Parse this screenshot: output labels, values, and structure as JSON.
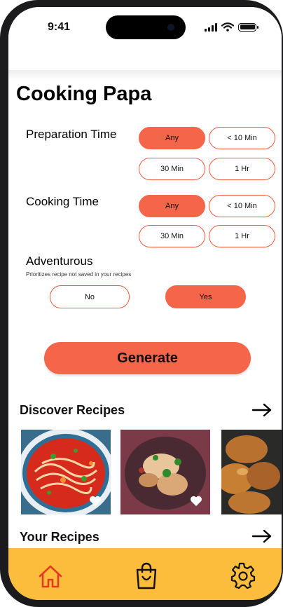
{
  "status": {
    "time": "9:41"
  },
  "app": {
    "title": "Cooking Papa"
  },
  "preparation": {
    "label": "Preparation Time",
    "options": [
      "Any",
      "< 10 Min",
      "30 Min",
      "1 Hr"
    ],
    "selected": "Any"
  },
  "cooking": {
    "label": "Cooking Time",
    "options": [
      "Any",
      "< 10 Min",
      "30 Min",
      "1 Hr"
    ],
    "selected": "Any"
  },
  "adventurous": {
    "label": "Adventurous",
    "description": "Prioritizes recipe not saved in your recipes",
    "options": [
      "No",
      "Yes"
    ],
    "selected": "Yes"
  },
  "generate_label": "Generate",
  "discover": {
    "title": "Discover Recipes",
    "cards": [
      {
        "image": "noodle-soup-photo",
        "favorite_icon": "heart-icon"
      },
      {
        "image": "fried-dish-photo",
        "favorite_icon": "heart-icon"
      },
      {
        "image": "chicken-wings-photo"
      }
    ]
  },
  "your_recipes": {
    "title": "Your Recipes"
  },
  "nav": {
    "items": [
      "home-icon",
      "shopping-bag-icon",
      "gear-icon"
    ],
    "active": "home-icon"
  },
  "colors": {
    "accent": "#f4654a",
    "nav_bg": "#fdbd3c",
    "icon_stroke": "#e23b22"
  }
}
